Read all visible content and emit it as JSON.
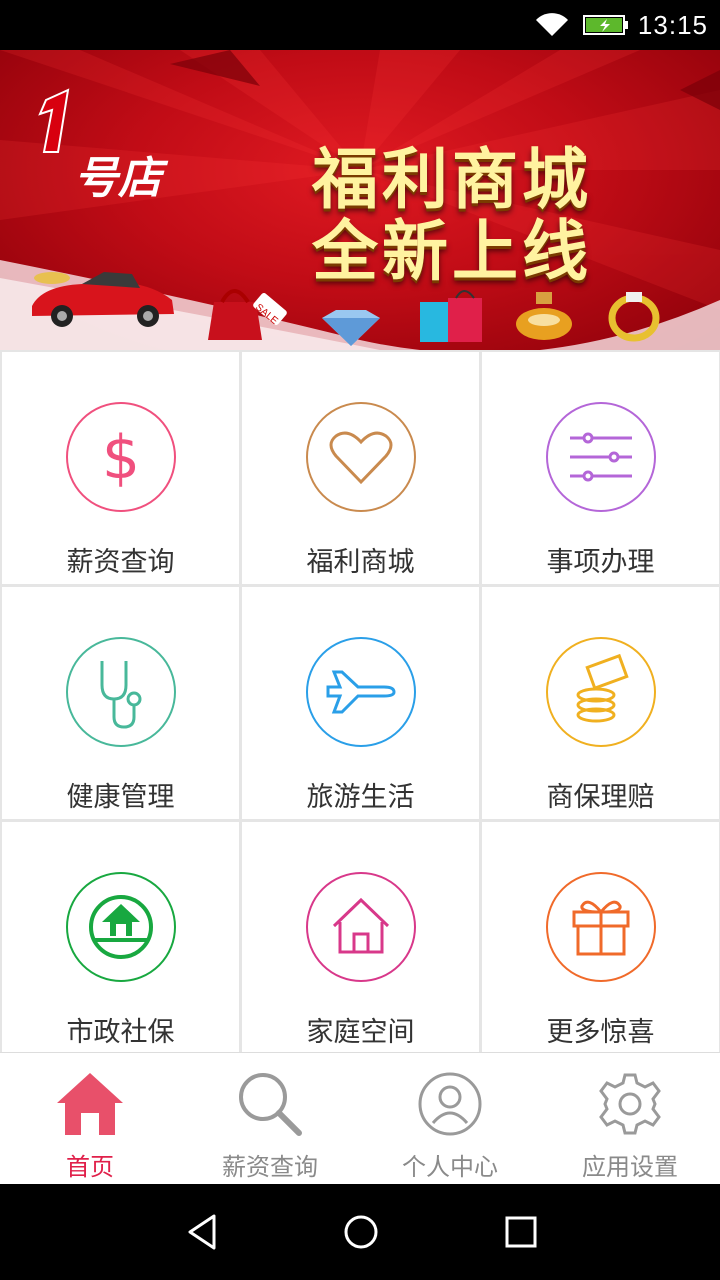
{
  "status_bar": {
    "time": "13:15",
    "wifi_icon": "wifi-icon",
    "battery_icon": "battery-charging-icon"
  },
  "banner": {
    "logo_text": "号店",
    "headline_line1": "福利商城",
    "headline_line2": "全新上线",
    "sale_tag": "SALE"
  },
  "grid": {
    "items": [
      {
        "label": "薪资查询",
        "icon": "dollar-icon",
        "color": "#f0507e"
      },
      {
        "label": "福利商城",
        "icon": "heart-icon",
        "color": "#c98a4e"
      },
      {
        "label": "事项办理",
        "icon": "sliders-icon",
        "color": "#b466d8"
      },
      {
        "label": "健康管理",
        "icon": "stethoscope-icon",
        "color": "#48b89a"
      },
      {
        "label": "旅游生活",
        "icon": "airplane-icon",
        "color": "#2a9fe8"
      },
      {
        "label": "商保理赔",
        "icon": "coins-icon",
        "color": "#f0b020"
      },
      {
        "label": "市政社保",
        "icon": "home-circle-icon",
        "color": "#18a840"
      },
      {
        "label": "家庭空间",
        "icon": "house-icon",
        "color": "#d8388a"
      },
      {
        "label": "更多惊喜",
        "icon": "gift-icon",
        "color": "#f06a2a"
      }
    ]
  },
  "bottom_nav": {
    "items": [
      {
        "label": "首页",
        "icon": "home-icon",
        "active": true
      },
      {
        "label": "薪资查询",
        "icon": "search-icon",
        "active": false
      },
      {
        "label": "个人中心",
        "icon": "user-icon",
        "active": false
      },
      {
        "label": "应用设置",
        "icon": "gear-icon",
        "active": false
      }
    ],
    "active_color": "#e0204a",
    "inactive_color": "#8a8a8a"
  },
  "system_nav": {
    "back_icon": "back-triangle-icon",
    "home_icon": "home-circle-nav-icon",
    "recents_icon": "recents-square-icon"
  }
}
